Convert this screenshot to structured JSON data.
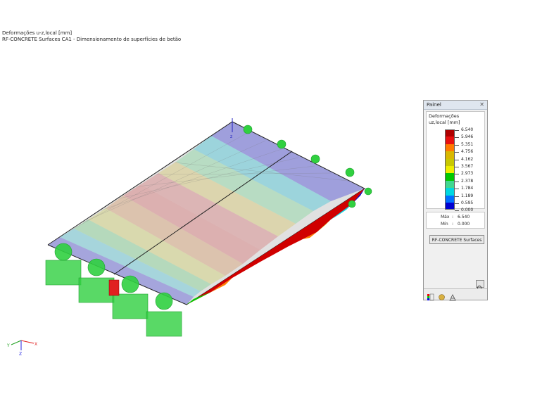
{
  "header": {
    "line1": "Deformações u-z,local [mm]",
    "line2": "RF-CONCRETE Surfaces CA1 - Dimensionamento de superfícies de betão"
  },
  "panel": {
    "title": "Painel",
    "section_label": "Deformações",
    "unit_label": "uz,local [mm]",
    "legend": [
      {
        "value": "6.540",
        "color": "#b00000"
      },
      {
        "value": "5.946",
        "color": "#e81010"
      },
      {
        "value": "5.351",
        "color": "#ff7a00"
      },
      {
        "value": "4.756",
        "color": "#d9b800"
      },
      {
        "value": "4.162",
        "color": "#c8c800"
      },
      {
        "value": "3.567",
        "color": "#eeee00"
      },
      {
        "value": "2.973",
        "color": "#00c800"
      },
      {
        "value": "2.378",
        "color": "#40d890"
      },
      {
        "value": "1.784",
        "color": "#00d8e0"
      },
      {
        "value": "1.189",
        "color": "#0070ff"
      },
      {
        "value": "0.595",
        "color": "#0000d0"
      },
      {
        "value": "0.000",
        "color": "#000090"
      }
    ],
    "max_label": "Máx",
    "max_value": "6.540",
    "min_label": "Mín",
    "min_value": "0.000",
    "separator": ":",
    "button_label": "RF-CONCRETE Surfaces"
  },
  "axes": {
    "x": "X",
    "y": "Y",
    "z": "Z"
  },
  "model_axis_label": "z",
  "icons": [
    "close-icon",
    "zoom-icon",
    "color-scale-icon",
    "values-icon",
    "filter-icon",
    "support-icon",
    "axes-icon"
  ]
}
